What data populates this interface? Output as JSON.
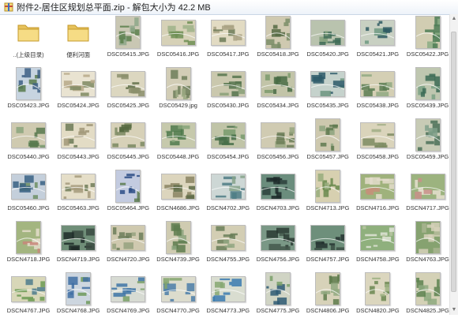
{
  "window": {
    "title": "附件2-居住区规划总平面.zip - 解包大小为 42.2 MB",
    "icon": "archive-icon"
  },
  "files": [
    {
      "name": "..(上级目录)",
      "kind": "folder"
    },
    {
      "name": "便利河面",
      "kind": "folder"
    },
    {
      "name": "DSC05415.JPG",
      "kind": "image",
      "shape": "portrait",
      "palette": [
        "#5a7f4c",
        "#c9c7b3",
        "#8ea78a"
      ]
    },
    {
      "name": "DSC05416.JPG",
      "kind": "image",
      "shape": "landscape",
      "palette": [
        "#6f8f55",
        "#d6d1b7",
        "#9fb38a"
      ]
    },
    {
      "name": "DSC05417.JPG",
      "kind": "image",
      "shape": "landscape",
      "palette": [
        "#a9a284",
        "#e2dbc3",
        "#6d7b58"
      ]
    },
    {
      "name": "DSC05418.JPG",
      "kind": "image",
      "shape": "portrait",
      "palette": [
        "#7a8d67",
        "#cfc9b0",
        "#566b44"
      ]
    },
    {
      "name": "DSC05420.JPG",
      "kind": "image",
      "shape": "landscape",
      "palette": [
        "#3f6c57",
        "#b9c3ae",
        "#83a07c"
      ]
    },
    {
      "name": "DSC05421.JPG",
      "kind": "image",
      "shape": "landscape",
      "palette": [
        "#2f5a63",
        "#c8d0c2",
        "#6e9a82"
      ]
    },
    {
      "name": "DSC05422.JPG",
      "kind": "image",
      "shape": "portrait",
      "palette": [
        "#4f7d56",
        "#d1cdb2",
        "#8cad85"
      ]
    },
    {
      "name": "DSC05423.JPG",
      "kind": "image",
      "shape": "portrait",
      "palette": [
        "#3d5f84",
        "#c7d4e0",
        "#577a4b"
      ]
    },
    {
      "name": "DSC05424.JPG",
      "kind": "image",
      "shape": "landscape",
      "palette": [
        "#b7a98a",
        "#e9e3d1",
        "#7f8a63"
      ]
    },
    {
      "name": "DSC05425.JPG",
      "kind": "image",
      "shape": "landscape",
      "palette": [
        "#8b8f6c",
        "#dcd7c0",
        "#5f6e48"
      ]
    },
    {
      "name": "DSC05429.jpg",
      "kind": "image",
      "shape": "portrait",
      "palette": [
        "#6f7e5a",
        "#d2cdb6",
        "#9aa881"
      ]
    },
    {
      "name": "DSC05430.JPG",
      "kind": "image",
      "shape": "landscape",
      "palette": [
        "#56744d",
        "#cac8ae",
        "#8aa079"
      ]
    },
    {
      "name": "DSC05434.JPG",
      "kind": "image",
      "shape": "landscape",
      "palette": [
        "#496c45",
        "#c2c4a8",
        "#7b9a6c"
      ]
    },
    {
      "name": "DSC05435.JPG",
      "kind": "image",
      "shape": "landscape",
      "palette": [
        "#2d5b69",
        "#c5d2cc",
        "#6c957f"
      ]
    },
    {
      "name": "DSC05438.JPG",
      "kind": "image",
      "shape": "landscape",
      "palette": [
        "#5b7d52",
        "#d4cfb4",
        "#90a983"
      ]
    },
    {
      "name": "DSC05439.JPG",
      "kind": "image",
      "shape": "portrait",
      "palette": [
        "#3c6b56",
        "#bfc7b0",
        "#7aa185"
      ]
    },
    {
      "name": "DSC05440.JPG",
      "kind": "image",
      "shape": "landscape",
      "palette": [
        "#58794f",
        "#cfcab0",
        "#8aa47c"
      ]
    },
    {
      "name": "DSC05443.JPG",
      "kind": "image",
      "shape": "landscape",
      "palette": [
        "#a19878",
        "#e3dcc5",
        "#6c7a57"
      ]
    },
    {
      "name": "DSC05445.JPG",
      "kind": "image",
      "shape": "landscape",
      "palette": [
        "#7b8a62",
        "#d7d1b8",
        "#55683f"
      ]
    },
    {
      "name": "DSC05448.JPG",
      "kind": "image",
      "shape": "landscape",
      "palette": [
        "#4f7a4c",
        "#c6c9ac",
        "#86a479"
      ]
    },
    {
      "name": "DSC05454.JPG",
      "kind": "image",
      "shape": "landscape",
      "palette": [
        "#466e49",
        "#c0c4a7",
        "#789b6d"
      ]
    },
    {
      "name": "DSC05456.JPG",
      "kind": "image",
      "shape": "landscape",
      "palette": [
        "#6b7d57",
        "#d0cbb2",
        "#96a67f"
      ]
    },
    {
      "name": "DSC05457.JPG",
      "kind": "image",
      "shape": "portrait",
      "palette": [
        "#5f7a50",
        "#cdc8ae",
        "#8da37e"
      ]
    },
    {
      "name": "DSC05458.JPG",
      "kind": "image",
      "shape": "landscape",
      "palette": [
        "#7d8b62",
        "#dad4bb",
        "#a1ae86"
      ]
    },
    {
      "name": "DSC05459.JPG",
      "kind": "image",
      "shape": "portrait",
      "palette": [
        "#4b7158",
        "#c7cbb5",
        "#7fa08a"
      ]
    },
    {
      "name": "DSC05460.JPG",
      "kind": "image",
      "shape": "landscape",
      "palette": [
        "#3a6284",
        "#c4cfdb",
        "#6f8f64"
      ]
    },
    {
      "name": "DSC05463.JPG",
      "kind": "image",
      "shape": "landscape",
      "palette": [
        "#a69b7d",
        "#e5dec8",
        "#707c58"
      ]
    },
    {
      "name": "DSC05464.JPG",
      "kind": "image",
      "shape": "portrait",
      "palette": [
        "#2e4f86",
        "#c3cbe0",
        "#5e7d50"
      ]
    },
    {
      "name": "DSCN4686.JPG",
      "kind": "image",
      "shape": "landscape",
      "palette": [
        "#8a8463",
        "#dcd5bd",
        "#5c6a45"
      ]
    },
    {
      "name": "DSCN4702.JPG",
      "kind": "image",
      "shape": "landscape",
      "palette": [
        "#4f7d85",
        "#cdd7d5",
        "#86a38a"
      ]
    },
    {
      "name": "DSCN4703.JPG",
      "kind": "image",
      "shape": "landscape",
      "palette": [
        "#1d2a2a",
        "#6b8d7d",
        "#2c3f3b"
      ]
    },
    {
      "name": "DSCN4713.JPG",
      "kind": "image",
      "shape": "portrait",
      "palette": [
        "#6a8a4e",
        "#d7d0b0",
        "#98ad7c"
      ]
    },
    {
      "name": "DSCN4716.JPG",
      "kind": "image",
      "shape": "landscape",
      "palette": [
        "#e3dccb",
        "#9fb27c",
        "#c4907a"
      ]
    },
    {
      "name": "DSCN4717.JPG",
      "kind": "image",
      "shape": "landscape",
      "palette": [
        "#e6dfcf",
        "#9cb37f",
        "#c98f89"
      ]
    },
    {
      "name": "DSCN4718.JPG",
      "kind": "image",
      "shape": "portrait",
      "palette": [
        "#e4ddca",
        "#a3b580",
        "#c9867a"
      ]
    },
    {
      "name": "DSCN4719.JPG",
      "kind": "image",
      "shape": "landscape",
      "palette": [
        "#1f2b28",
        "#6f8e78",
        "#3a4a41"
      ]
    },
    {
      "name": "DSCN4720.JPG",
      "kind": "image",
      "shape": "landscape",
      "palette": [
        "#6c7e5a",
        "#cfc9af",
        "#95a27f"
      ]
    },
    {
      "name": "DSCN4739.JPG",
      "kind": "image",
      "shape": "portrait",
      "palette": [
        "#5e7c4f",
        "#cfcbb1",
        "#8ca47e"
      ]
    },
    {
      "name": "DSCN4755.JPG",
      "kind": "image",
      "shape": "landscape",
      "palette": [
        "#6a7f59",
        "#d3ceb4",
        "#93a782"
      ]
    },
    {
      "name": "DSCN4756.JPG",
      "kind": "image",
      "shape": "landscape",
      "palette": [
        "#2a3a32",
        "#7a9886",
        "#44584c"
      ]
    },
    {
      "name": "DSCN4757.JPG",
      "kind": "image",
      "shape": "landscape",
      "palette": [
        "#243330",
        "#6e8f7b",
        "#3b4f44"
      ]
    },
    {
      "name": "DSCN4758.JPG",
      "kind": "image",
      "shape": "landscape",
      "palette": [
        "#dfe4d6",
        "#8fb07d",
        "#b9c5a2"
      ]
    },
    {
      "name": "DSCN4763.JPG",
      "kind": "image",
      "shape": "portrait",
      "palette": [
        "#d6d1ba",
        "#86a270",
        "#a9b591"
      ]
    },
    {
      "name": "DSCN4767.JPG",
      "kind": "image",
      "shape": "landscape",
      "palette": [
        "#6d9b54",
        "#d8d7b8",
        "#4f7d8c"
      ]
    },
    {
      "name": "DSCN4768.JPG",
      "kind": "image",
      "shape": "portrait",
      "palette": [
        "#3f6fa3",
        "#cdd6df",
        "#6f9a5c"
      ]
    },
    {
      "name": "DSCN4769.JPG",
      "kind": "image",
      "shape": "landscape",
      "palette": [
        "#3e74a6",
        "#d7dbd3",
        "#7aa067"
      ]
    },
    {
      "name": "DSCN4770.JPG",
      "kind": "image",
      "shape": "landscape",
      "palette": [
        "#4c7ea8",
        "#dcdccd",
        "#83a46c"
      ]
    },
    {
      "name": "DSCN4773.JPG",
      "kind": "image",
      "shape": "landscape",
      "palette": [
        "#3b7bb0",
        "#d9ddd0",
        "#86a872"
      ]
    },
    {
      "name": "DSCN4775.JPG",
      "kind": "image",
      "shape": "portrait",
      "palette": [
        "#2f5a74",
        "#d0d4c4",
        "#7aa06a"
      ]
    },
    {
      "name": "DSCN4806.JPG",
      "kind": "image",
      "shape": "portrait",
      "palette": [
        "#5f7d4c",
        "#d7d2b9",
        "#92a980"
      ]
    },
    {
      "name": "DSCN4820.JPG",
      "kind": "image",
      "shape": "portrait",
      "palette": [
        "#6b8752",
        "#dbd6be",
        "#9db283"
      ]
    },
    {
      "name": "DSCN4825.JPG",
      "kind": "image",
      "shape": "portrait",
      "palette": [
        "#5d8350",
        "#d4d1b6",
        "#8eaa80"
      ]
    }
  ]
}
